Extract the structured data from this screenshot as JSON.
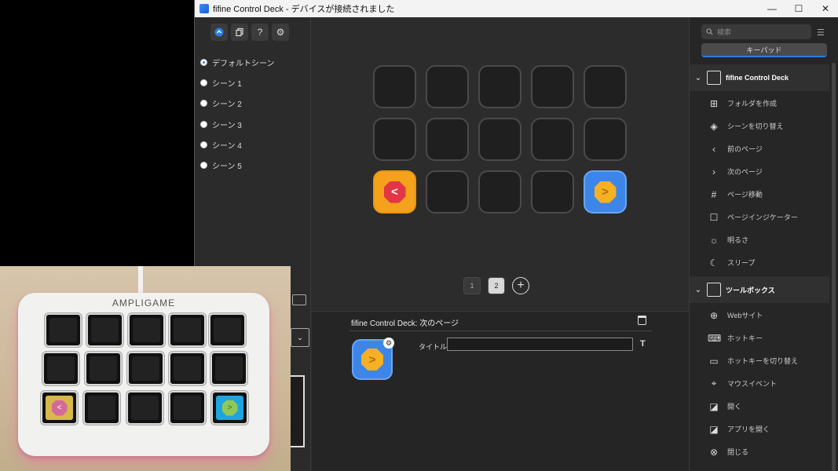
{
  "window": {
    "title": "fifine Control Deck - デバイスが接続されました",
    "minimize": "—",
    "maximize": "☐",
    "close": "✕"
  },
  "toolbar": {
    "buttons": [
      "home-icon",
      "copy-icon",
      "help-icon",
      "gear-icon"
    ],
    "help_label": "?",
    "gear_label": "⚙"
  },
  "scenes": [
    {
      "label": "デフォルトシーン",
      "selected": true
    },
    {
      "label": "シーン 1",
      "selected": false
    },
    {
      "label": "シーン 2",
      "selected": false
    },
    {
      "label": "シーン 3",
      "selected": false
    },
    {
      "label": "シーン 4",
      "selected": false
    },
    {
      "label": "シーン 5",
      "selected": false
    }
  ],
  "keys": {
    "prev_glyph": "<",
    "next_glyph": ">"
  },
  "pager": {
    "page1": "1",
    "page2": "2",
    "add": "+"
  },
  "props": {
    "header": "fifine Control Deck: 次のページ",
    "title_label": "タイトル :",
    "title_value": "",
    "text_button": "T",
    "key_glyph": ">"
  },
  "right": {
    "search_placeholder": "検索",
    "keypad_tab": "キーパッド",
    "group1": "fifine Control Deck",
    "group1_items": [
      "フォルダを作成",
      "シーンを切り替え",
      "前のページ",
      "次のページ",
      "ページ移動",
      "ページインジケーター",
      "明るさ",
      "スリープ"
    ],
    "group2": "ツールボックス",
    "group2_items": [
      "Webサイト",
      "ホットキー",
      "ホットキーを切り替え",
      "マウスイベント",
      "開く",
      "アプリを開く",
      "閉じる"
    ]
  },
  "photo": {
    "brand": "AMPLIGAME"
  }
}
